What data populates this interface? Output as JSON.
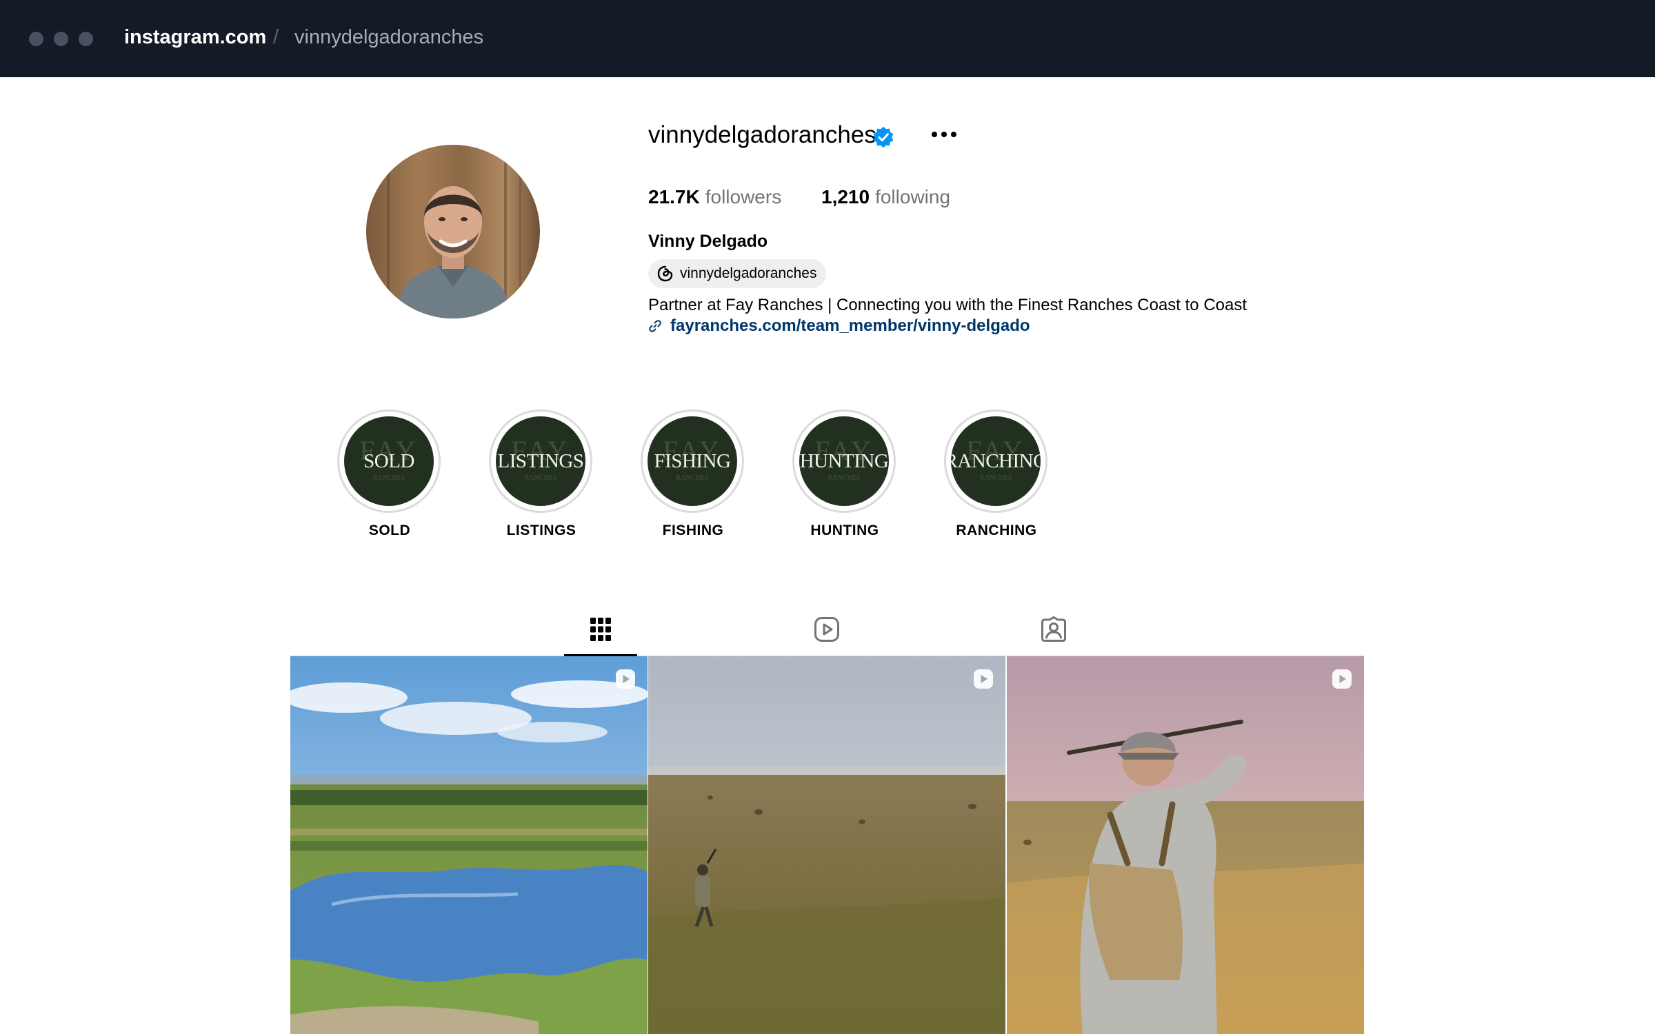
{
  "browser": {
    "host": "instagram.com",
    "separator": "/",
    "path": "vinnydelgadoranches"
  },
  "profile": {
    "username": "vinnydelgadoranches",
    "verified": true,
    "followers_count": "21.7K",
    "followers_label": "followers",
    "following_count": "1,210",
    "following_label": "following",
    "full_name": "Vinny Delgado",
    "threads_handle": "vinnydelgadoranches",
    "bio": "Partner at Fay Ranches | Connecting you with the Finest Ranches Coast to Coast",
    "link": "fayranches.com/team_member/vinny-delgado"
  },
  "highlights": [
    {
      "cover_text": "SOLD",
      "label": "SOLD",
      "brand_mark": "FAY",
      "brand_sub": "RANCHES"
    },
    {
      "cover_text": "LISTINGS",
      "label": "LISTINGS",
      "brand_mark": "FAY",
      "brand_sub": "RANCHES"
    },
    {
      "cover_text": "FISHING",
      "label": "FISHING",
      "brand_mark": "FAY",
      "brand_sub": "RANCHES"
    },
    {
      "cover_text": "HUNTING",
      "label": "HUNTING",
      "brand_mark": "FAY",
      "brand_sub": "RANCHES"
    },
    {
      "cover_text": "RANCHING",
      "label": "RANCHING",
      "brand_mark": "FAY",
      "brand_sub": "RANCHES"
    }
  ],
  "tabs": [
    {
      "icon": "grid-icon",
      "active": true
    },
    {
      "icon": "reels-icon",
      "active": false
    },
    {
      "icon": "tagged-icon",
      "active": false
    }
  ],
  "posts": [
    {
      "type": "reel",
      "scene": "aerial view of ranch pond and green pastures"
    },
    {
      "type": "reel",
      "scene": "hunter walking across open grassland with hay bales"
    },
    {
      "type": "reel",
      "scene": "hunter in cap aiming rifle over golden prairie"
    }
  ],
  "colors": {
    "titlebar": "#151b26",
    "verified": "#0095f6",
    "link": "#00376b",
    "highlight_disc": "#22311f",
    "divider": "#dbdbdb"
  }
}
